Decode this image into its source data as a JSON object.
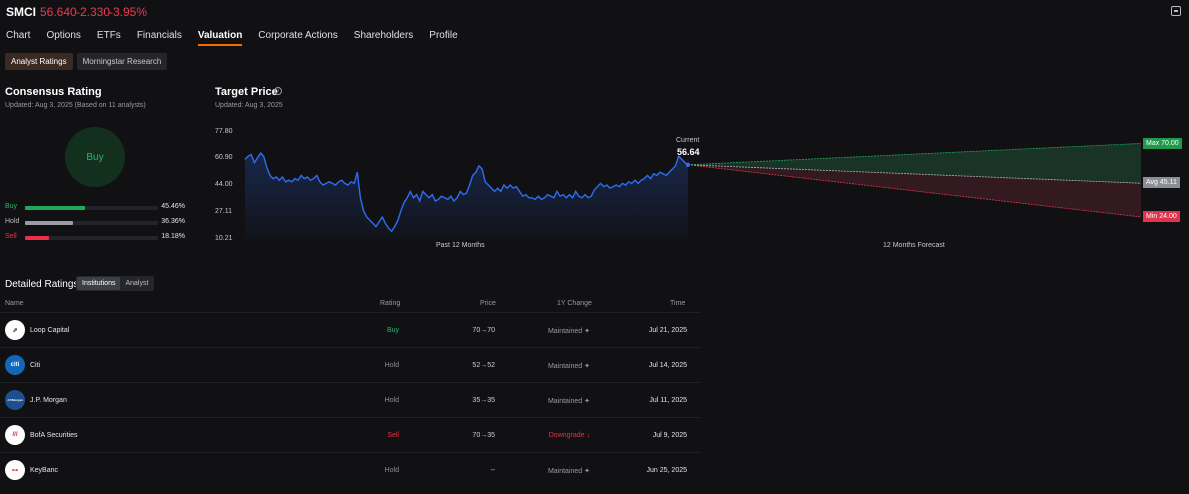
{
  "header": {
    "ticker": "SMCI",
    "price": "56.640",
    "change": "-2.330",
    "change_pct": "-3.95%"
  },
  "tabs": [
    "Chart",
    "Options",
    "ETFs",
    "Financials",
    "Valuation",
    "Corporate Actions",
    "Shareholders",
    "Profile"
  ],
  "active_tab": "Valuation",
  "subtabs": [
    "Analyst Ratings",
    "Morningstar Research"
  ],
  "consensus": {
    "title": "Consensus Rating",
    "updated": "Updated: Aug 3, 2025 (Based on 11 analysts)",
    "rating": "Buy",
    "bars": [
      {
        "label": "Buy",
        "pct": "45.46%",
        "value": 45.46,
        "color": "#1fa85a",
        "label_color": "#2db36a"
      },
      {
        "label": "Hold",
        "pct": "36.36%",
        "value": 36.36,
        "color": "#9a9ca3",
        "label_color": "#bdbdbd"
      },
      {
        "label": "Sell",
        "pct": "18.18%",
        "value": 18.18,
        "color": "#e8314a",
        "label_color": "#e8314a"
      }
    ]
  },
  "target": {
    "title": "Target Price",
    "info_icon": "info-icon",
    "updated": "Updated: Aug 3, 2025",
    "current_label": "Current",
    "current_value": "56.64",
    "y_ticks": [
      "77.80",
      "60.90",
      "44.00",
      "27.11",
      "10.21"
    ],
    "past_label": "Past 12 Months",
    "forecast_label": "12 Months Forecast",
    "max_label": "Max  70.00",
    "avg_label": "Avg  45.11",
    "min_label": "Min  24.00"
  },
  "chart_data": {
    "type": "line",
    "ylim": [
      10.21,
      77.8
    ],
    "series": [
      {
        "values": [
          60,
          62,
          63,
          58,
          61,
          64,
          62,
          55,
          50,
          48,
          49,
          47,
          49,
          46,
          47,
          46,
          48,
          47,
          50,
          48,
          49,
          47,
          48,
          50,
          46,
          44,
          45,
          46,
          45,
          44,
          46,
          47,
          45,
          44,
          46,
          45,
          52,
          36,
          28,
          24,
          22,
          20,
          18,
          21,
          24,
          20,
          17,
          15,
          18,
          22,
          28,
          33,
          36,
          40,
          36,
          38,
          34,
          40,
          38,
          36,
          38,
          34,
          35,
          37,
          36,
          35,
          37,
          34,
          36,
          40,
          38,
          39,
          44,
          50,
          52,
          56,
          54,
          46,
          44,
          42,
          40,
          42,
          40,
          44,
          42,
          44,
          42,
          43,
          40,
          37,
          38,
          36,
          36,
          35,
          37,
          35,
          36,
          38,
          37,
          36,
          40,
          37,
          38,
          36,
          38,
          36,
          40,
          37,
          36,
          38,
          36,
          37,
          41,
          43,
          45,
          43,
          44,
          42,
          43,
          44,
          43,
          45,
          44,
          46,
          45,
          47,
          45,
          47,
          48,
          50,
          48,
          51,
          50,
          52,
          51,
          50,
          52,
          54,
          56,
          62,
          60,
          58,
          56.64
        ]
      }
    ],
    "forecast": {
      "current": 56.64,
      "max": 70.0,
      "avg": 45.11,
      "min": 24.0
    }
  },
  "detailed": {
    "title": "Detailed Ratings",
    "tabs": [
      "Institutions",
      "Analyst"
    ],
    "headers": {
      "name": "Name",
      "rating": "Rating",
      "price": "Price",
      "change": "1Y Change",
      "time": "Time"
    },
    "rows": [
      {
        "name": "Loop Capital",
        "rating": "Buy",
        "rating_color": "#2db36a",
        "price": "70→70",
        "change": "Maintained ✦",
        "change_color": "#9a9aa0",
        "time": "Jul 21, 2025",
        "logo_text": "⇗",
        "logo_bg": "#ffffff",
        "logo_fg": "#222"
      },
      {
        "name": "Citi",
        "rating": "Hold",
        "rating_color": "#8f8f95",
        "price": "52→52",
        "change": "Maintained ✦",
        "change_color": "#9a9aa0",
        "time": "Jul 14, 2025",
        "logo_text": "citi",
        "logo_bg": "#1466b8",
        "logo_fg": "#ffffff"
      },
      {
        "name": "J.P. Morgan",
        "rating": "Hold",
        "rating_color": "#8f8f95",
        "price": "35→35",
        "change": "Maintained ✦",
        "change_color": "#9a9aa0",
        "time": "Jul 11, 2025",
        "logo_text": "J.P.Morgan",
        "logo_bg": "#1d4e8f",
        "logo_fg": "#ffffff"
      },
      {
        "name": "BofA Securities",
        "rating": "Sell",
        "rating_color": "#e8314a",
        "price": "70→35",
        "change": "Downgrade ↓",
        "change_color": "#e8314a",
        "time": "Jul 9, 2025",
        "logo_text": "///",
        "logo_bg": "#ffffff",
        "logo_fg": "#d6202e"
      },
      {
        "name": "KeyBanc",
        "rating": "Hold",
        "rating_color": "#8f8f95",
        "price": "--",
        "change": "Maintained ✦",
        "change_color": "#9a9aa0",
        "time": "Jun 25, 2025",
        "logo_text": "⊶",
        "logo_bg": "#ffffff",
        "logo_fg": "#d6202e"
      }
    ]
  }
}
